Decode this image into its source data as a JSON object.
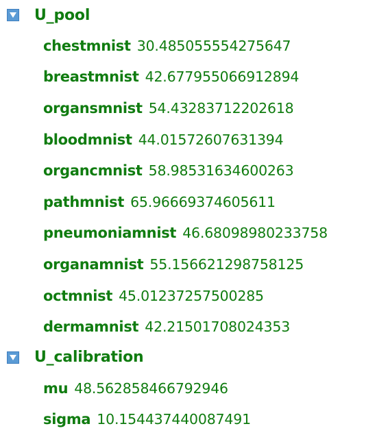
{
  "tree": {
    "groups": [
      {
        "title": "U_pool",
        "expanded": true,
        "icon": "collapse-triangle-icon",
        "items": [
          {
            "key": "chestmnist",
            "value": "30.485055554275647"
          },
          {
            "key": "breastmnist",
            "value": "42.677955066912894"
          },
          {
            "key": "organsmnist",
            "value": "54.43283712202618"
          },
          {
            "key": "bloodmnist",
            "value": "44.01572607631394"
          },
          {
            "key": "organcmnist",
            "value": "58.98531634600263"
          },
          {
            "key": "pathmnist",
            "value": "65.96669374605611"
          },
          {
            "key": "pneumoniamnist",
            "value": "46.68098980233758"
          },
          {
            "key": "organamnist",
            "value": "55.156621298758125"
          },
          {
            "key": "octmnist",
            "value": "45.01237257500285"
          },
          {
            "key": "dermamnist",
            "value": "42.21501708024353"
          }
        ]
      },
      {
        "title": "U_calibration",
        "expanded": true,
        "icon": "collapse-triangle-icon",
        "items": [
          {
            "key": "mu",
            "value": "48.562858466792946"
          },
          {
            "key": "sigma",
            "value": "10.154437440087491"
          }
        ]
      }
    ]
  },
  "colors": {
    "text": "#107c10",
    "toggle_fill": "#5b9bd5",
    "background": "#ffffff"
  }
}
